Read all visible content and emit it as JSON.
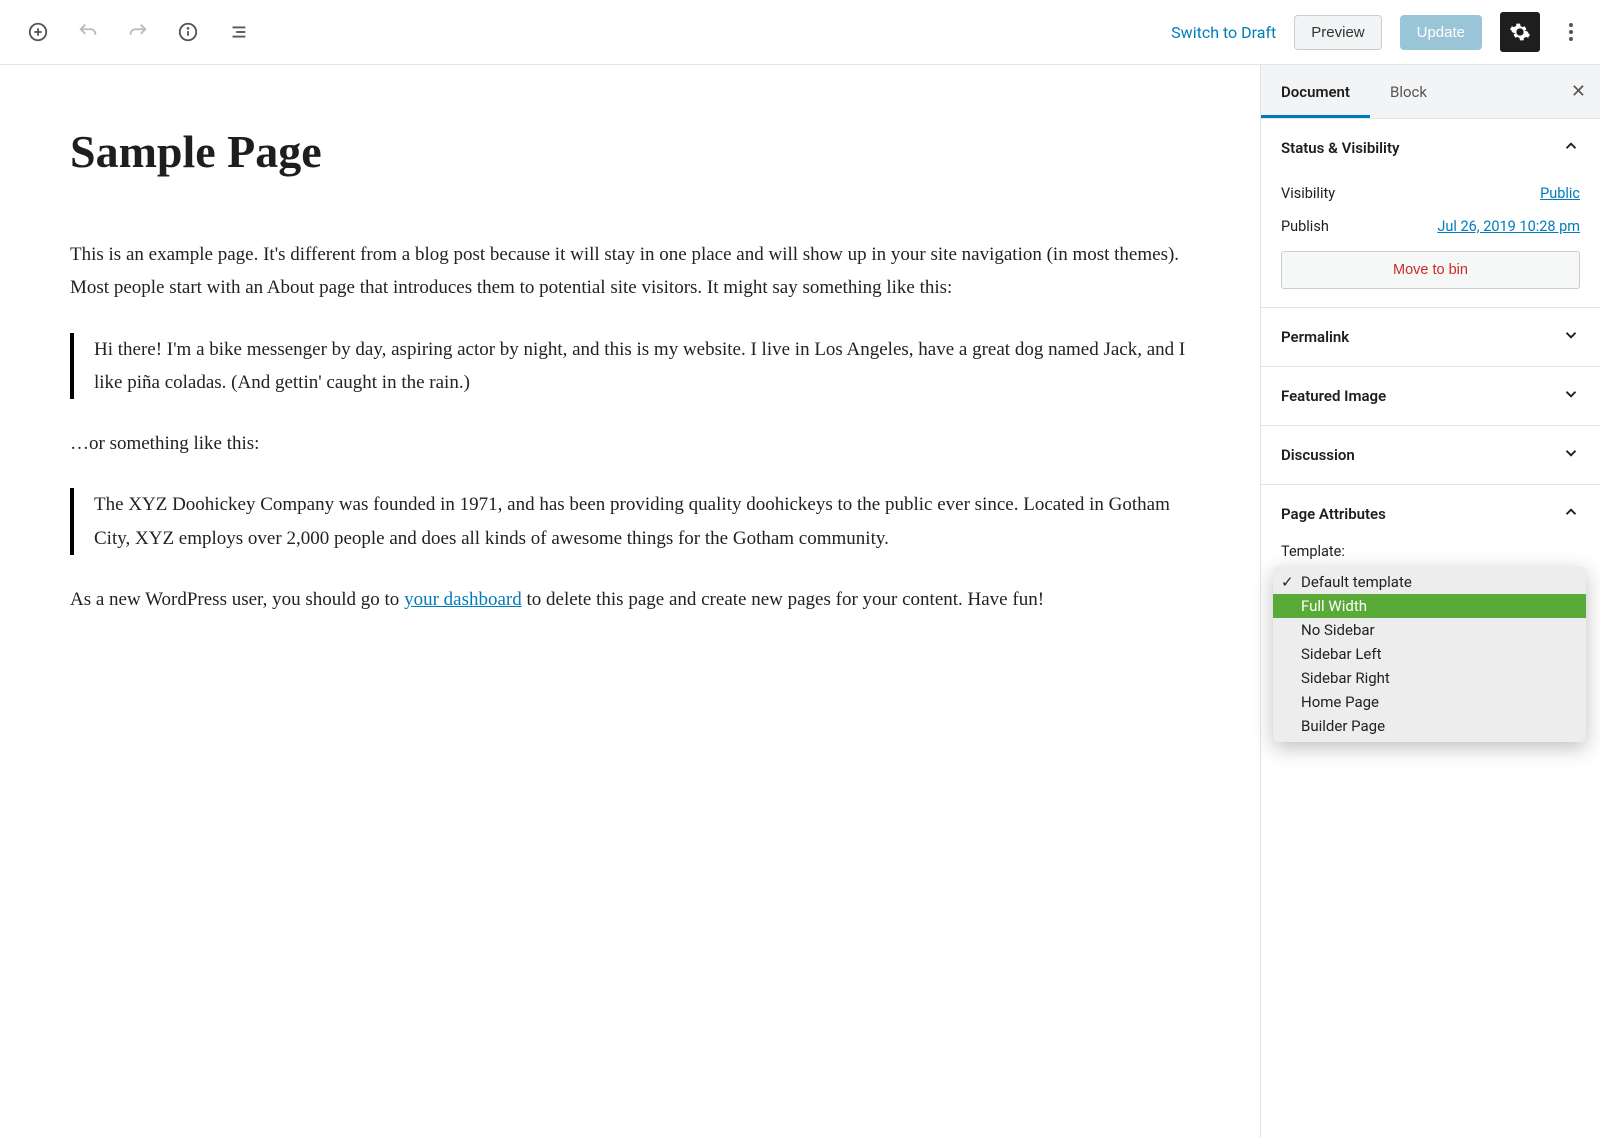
{
  "toolbar": {
    "switch_to_draft": "Switch to Draft",
    "preview": "Preview",
    "update": "Update"
  },
  "editor": {
    "title": "Sample Page",
    "p1": "This is an example page. It's different from a blog post because it will stay in one place and will show up in your site navigation (in most themes). Most people start with an About page that introduces them to potential site visitors. It might say something like this:",
    "quote1": "Hi there! I'm a bike messenger by day, aspiring actor by night, and this is my website. I live in Los Angeles, have a great dog named Jack, and I like piña coladas. (And gettin' caught in the rain.)",
    "p2": "…or something like this:",
    "quote2": "The XYZ Doohickey Company was founded in 1971, and has been providing quality doohickeys to the public ever since. Located in Gotham City, XYZ employs over 2,000 people and does all kinds of awesome things for the Gotham community.",
    "p3_pre": "As a new WordPress user, you should go to ",
    "p3_link": "your dashboard",
    "p3_post": " to delete this page and create new pages for your content. Have fun!"
  },
  "sidebar": {
    "tabs": {
      "document": "Document",
      "block": "Block"
    },
    "panels": {
      "status": {
        "title": "Status & Visibility",
        "visibility_label": "Visibility",
        "visibility_value": "Public",
        "publish_label": "Publish",
        "publish_value": "Jul 26, 2019 10:28 pm",
        "trash": "Move to bin"
      },
      "permalink": "Permalink",
      "featured": "Featured Image",
      "discussion": "Discussion",
      "page_attributes": {
        "title": "Page Attributes",
        "template_label": "Template:",
        "options": [
          {
            "label": "Default template",
            "checked": true
          },
          {
            "label": "Full Width",
            "highlight": true
          },
          {
            "label": "No Sidebar"
          },
          {
            "label": "Sidebar Left"
          },
          {
            "label": "Sidebar Right"
          },
          {
            "label": "Home Page"
          },
          {
            "label": "Builder Page"
          }
        ]
      }
    }
  }
}
